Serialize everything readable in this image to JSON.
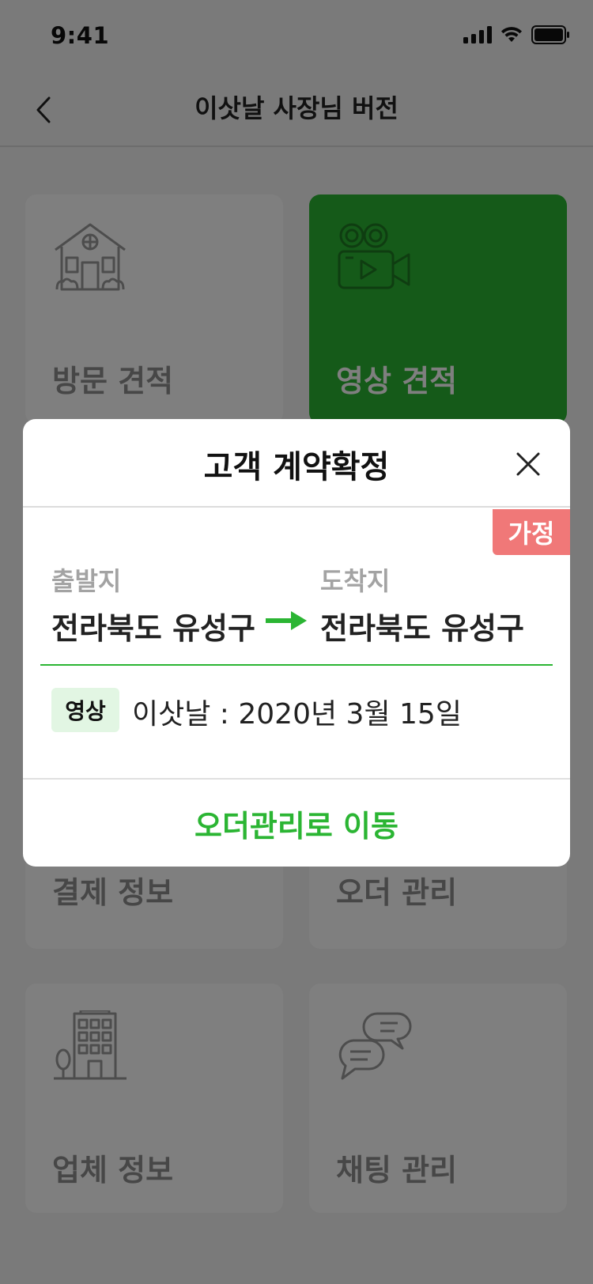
{
  "status_bar": {
    "time": "9:41"
  },
  "nav": {
    "title": "이삿날 사장님 버전"
  },
  "menu": {
    "visit_estimate": "방문 견적",
    "video_estimate": "영상 견적",
    "payment_info": "결제 정보",
    "order_management": "오더 관리",
    "company_info": "업체 정보",
    "chat_management": "채팅 관리"
  },
  "modal": {
    "title": "고객 계약확정",
    "tag": "가정",
    "from_label": "출발지",
    "from_value": "전라북도 유성구",
    "to_label": "도착지",
    "to_value": "전라북도 유성구",
    "type_chip": "영상",
    "move_date_text": "이삿날 : 2020년 3월 15일",
    "action_link": "오더관리로 이동"
  },
  "colors": {
    "accent_green": "#2bb533",
    "tag_red": "#f07878",
    "chip_bg": "#e2f6e3"
  }
}
